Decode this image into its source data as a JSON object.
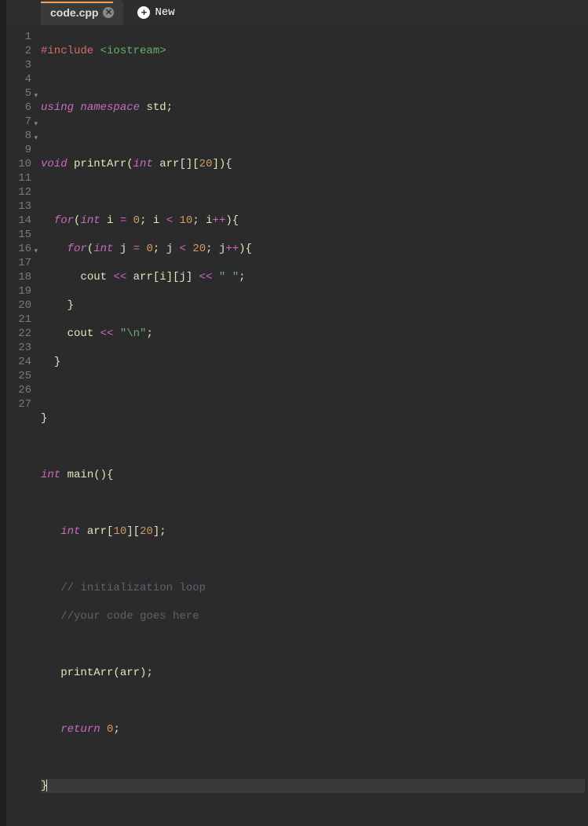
{
  "tabs": {
    "active": "code.cpp",
    "new_label": "New"
  },
  "gutter": {
    "lines": [
      "1",
      "2",
      "3",
      "4",
      "5",
      "6",
      "7",
      "8",
      "9",
      "10",
      "11",
      "12",
      "13",
      "14",
      "15",
      "16",
      "17",
      "18",
      "19",
      "20",
      "21",
      "22",
      "23",
      "24",
      "25",
      "26",
      "27"
    ],
    "fold_lines": [
      5,
      7,
      8,
      16
    ]
  },
  "code": {
    "l1": {
      "include_kw": "#include ",
      "header": "<iostream>"
    },
    "l3": {
      "using": "using ",
      "namespace": "namespace ",
      "std": "std",
      "semi": ";"
    },
    "l5": {
      "void": "void ",
      "fn": "printArr",
      "op": "(",
      "int": "int ",
      "arr": "arr[][",
      "n": "20",
      "close": "]){"
    },
    "l7": {
      "indent": "  ",
      "for": "for",
      "op": "(",
      "int": "int ",
      "var": "i ",
      "eq": "= ",
      "z": "0",
      "semi": "; ",
      "var2": "i ",
      "lt": "< ",
      "lim": "10",
      "semi2": "; ",
      "var3": "i",
      "inc": "++",
      "close": "){"
    },
    "l8": {
      "indent": "    ",
      "for": "for",
      "op": "(",
      "int": "int ",
      "var": "j ",
      "eq": "= ",
      "z": "0",
      "semi": "; ",
      "var2": "j ",
      "lt": "< ",
      "lim": "20",
      "semi2": "; ",
      "var3": "j",
      "inc": "++",
      "close": "){"
    },
    "l9": {
      "indent": "      ",
      "cout": "cout ",
      "ls": "<< ",
      "arr": "arr[i][j] ",
      "ls2": "<< ",
      "str": "\" \"",
      "semi": ";"
    },
    "l10": {
      "indent": "    ",
      "brace": "}"
    },
    "l11": {
      "indent": "    ",
      "cout": "cout ",
      "ls": "<< ",
      "str": "\"\\n\"",
      "semi": ";"
    },
    "l12": {
      "indent": "  ",
      "brace": "}"
    },
    "l14": {
      "brace": "}"
    },
    "l16": {
      "int": "int ",
      "fn": "main",
      "op": "()",
      "brace": "{"
    },
    "l18": {
      "indent": "   ",
      "int": "int ",
      "arr": "arr[",
      "n1": "10",
      "mid": "][",
      "n2": "20",
      "close": "];"
    },
    "l20": {
      "indent": "   ",
      "cmt": "// initialization loop"
    },
    "l21": {
      "indent": "   ",
      "cmt": "//your code goes here"
    },
    "l23": {
      "indent": "   ",
      "fn": "printArr(arr)",
      "semi": ";"
    },
    "l25": {
      "indent": "   ",
      "ret": "return ",
      "z": "0",
      "semi": ";"
    },
    "l27": {
      "brace": "}"
    }
  }
}
